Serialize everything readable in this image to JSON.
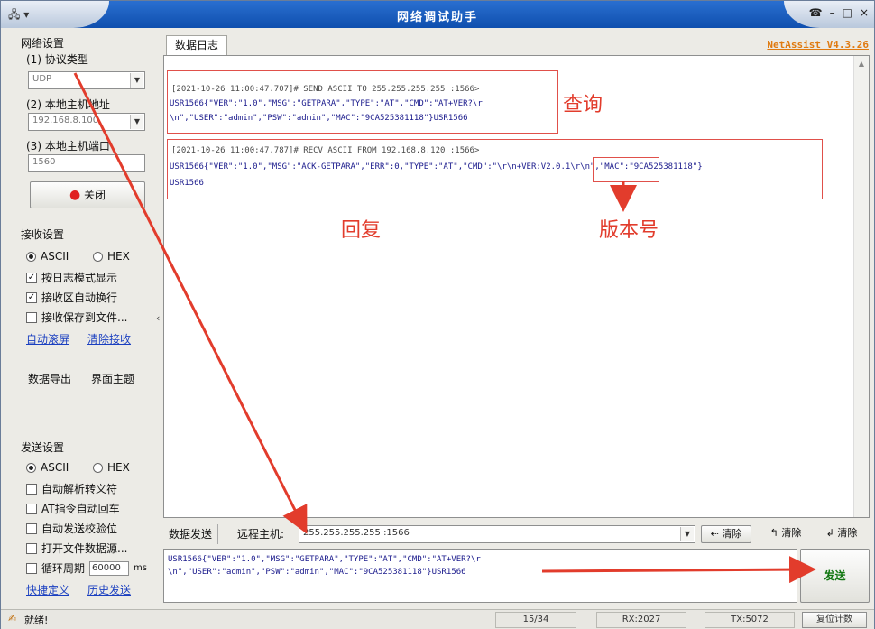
{
  "window": {
    "app_icon": "🖧 ▾",
    "title": "网络调试助手",
    "controls": [
      "☎",
      "–",
      "□",
      "×"
    ]
  },
  "network_settings": {
    "group_title": "网络设置",
    "protocol_label": "(1) 协议类型",
    "protocol_value": "UDP",
    "host_addr_label": "(2) 本地主机地址",
    "host_addr_value": "192.168.8.100",
    "host_port_label": "(3) 本地主机端口",
    "host_port_value": "1560",
    "close_button": "关闭"
  },
  "recv_settings": {
    "group_title": "接收设置",
    "ascii": "ASCII",
    "hex": "HEX",
    "opt_log_mode": "按日志模式显示",
    "opt_auto_wrap": "接收区自动换行",
    "opt_save_file": "接收保存到文件...",
    "link_auto_scroll": "自动滚屏",
    "link_clear": "清除接收"
  },
  "data_export": {
    "export": "数据导出",
    "theme": "界面主题"
  },
  "send_settings": {
    "group_title": "发送设置",
    "ascii": "ASCII",
    "hex": "HEX",
    "opt_escape": "自动解析转义符",
    "opt_at_cr": "AT指令自动回车",
    "opt_checksum": "自动发送校验位",
    "opt_open_file": "打开文件数据源...",
    "opt_loop": "循环周期",
    "loop_value": "60000",
    "loop_unit": "ms",
    "link_shortcut": "快捷定义",
    "link_history": "历史发送"
  },
  "log": {
    "tab_label": "数据日志",
    "version": "NetAssist V4.3.26",
    "entries": [
      {
        "head": "[2021-10-26 11:00:47.707]# SEND ASCII TO 255.255.255.255 :1566>",
        "body1": "USR1566{\"VER\":\"1.0\",\"MSG\":\"GETPARA\",\"TYPE\":\"AT\",\"CMD\":\"AT+VER?\\r",
        "body2": "\\n\",\"USER\":\"admin\",\"PSW\":\"admin\",\"MAC\":\"9CA525381118\"}USR1566"
      },
      {
        "head": "[2021-10-26 11:00:47.787]# RECV ASCII FROM 192.168.8.120 :1566>",
        "body1": "USR1566{\"VER\":\"1.0\",\"MSG\":\"ACK-GETPARA\",\"ERR\":0,\"TYPE\":\"AT\",\"CMD\":\"\\r\\n+VER:V2.0.1\\r\\n\",\"MAC\":\"9CA525381118\"}",
        "body2": "USR1566"
      }
    ],
    "annotation_query": "查询",
    "annotation_reply": "回复",
    "annotation_version": "版本号"
  },
  "send_bar": {
    "data_send_label": "数据发送",
    "remote_host_label": "远程主机:",
    "remote_host_value": "255.255.255.255 :1566",
    "clear1": "清除",
    "clear2": "清除",
    "clear3": "清除"
  },
  "send_area": {
    "text1": "USR1566{\"VER\":\"1.0\",\"MSG\":\"GETPARA\",\"TYPE\":\"AT\",\"CMD\":\"AT+VER?\\r",
    "text2": "\\n\",\"USER\":\"admin\",\"PSW\":\"admin\",\"MAC\":\"9CA525381118\"}USR1566",
    "send_button": "发送"
  },
  "status_bar": {
    "ready": "就绪!",
    "counter": "15/34",
    "rx": "RX:2027",
    "tx": "TX:5072",
    "reset": "复位计数"
  },
  "colors": {
    "annotation": "#e23c2c",
    "title_bar": "#1a5cc0",
    "version": "#e07a10"
  }
}
